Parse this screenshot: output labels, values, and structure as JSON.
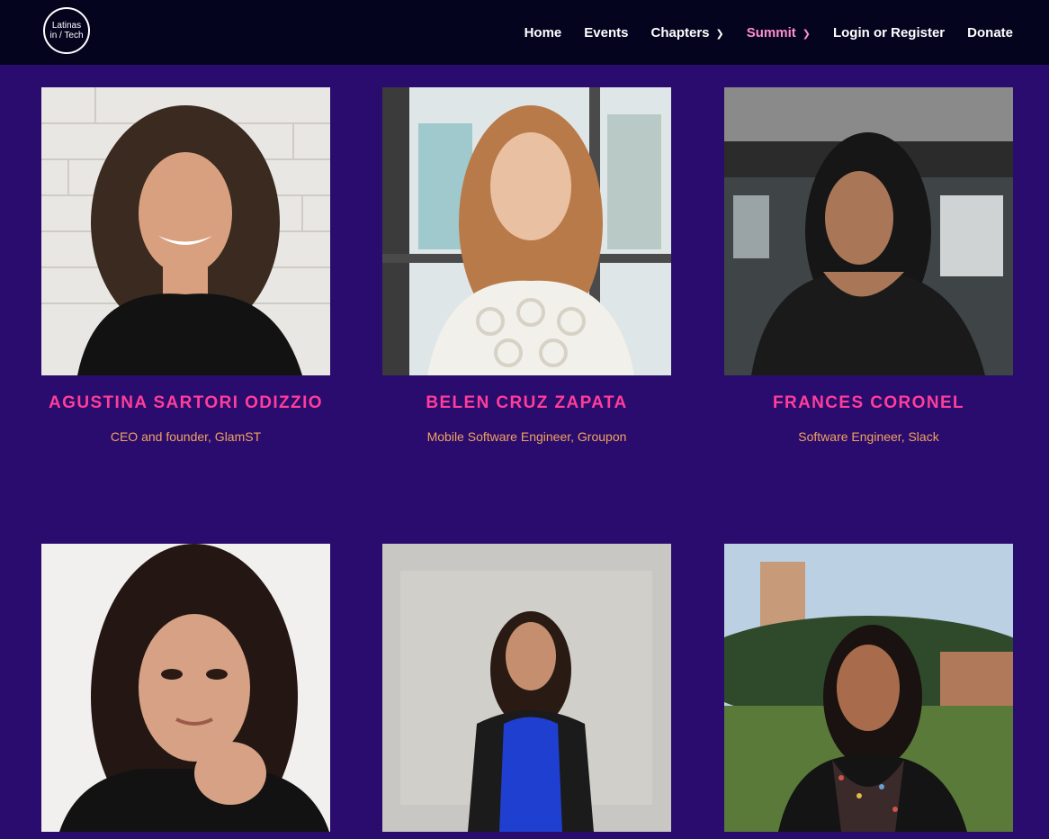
{
  "header": {
    "logo_line1": "Latinas",
    "logo_line2": "in / Tech",
    "nav": [
      {
        "label": "Home",
        "has_dropdown": false,
        "active": false
      },
      {
        "label": "Events",
        "has_dropdown": false,
        "active": false
      },
      {
        "label": "Chapters",
        "has_dropdown": true,
        "active": false
      },
      {
        "label": "Summit",
        "has_dropdown": true,
        "active": true
      },
      {
        "label": "Login or Register",
        "has_dropdown": false,
        "active": false
      },
      {
        "label": "Donate",
        "has_dropdown": false,
        "active": false
      }
    ]
  },
  "speakers": [
    {
      "name": "AGUSTINA SARTORI ODIZZIO",
      "role": "CEO and founder, GlamST"
    },
    {
      "name": "BELEN CRUZ ZAPATA",
      "role": "Mobile Software Engineer, Groupon"
    },
    {
      "name": "FRANCES CORONEL",
      "role": "Software Engineer, Slack"
    }
  ],
  "colors": {
    "page_bg": "#2a0c6e",
    "topbar_bg": "#04041f",
    "name": "#ff3d9a",
    "role": "#f0a25e",
    "nav_active": "#ff8fcb"
  }
}
